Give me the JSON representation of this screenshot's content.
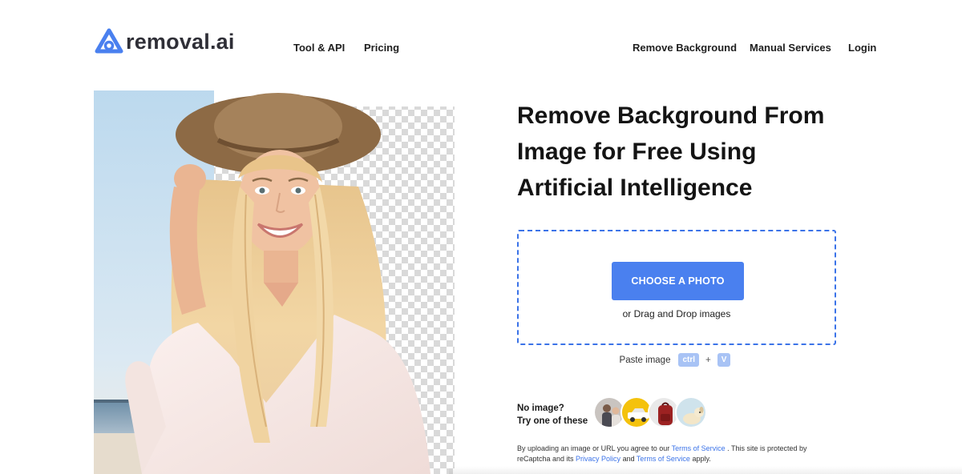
{
  "brand": {
    "name": "removal.ai",
    "accent": "#4a80ef",
    "logo_icon": "removal-ai-logo-icon"
  },
  "nav": {
    "left": [
      {
        "label": "Tool & API"
      },
      {
        "label": "Pricing"
      }
    ],
    "right": [
      {
        "label": "Remove Background"
      },
      {
        "label": "Manual Services"
      },
      {
        "label": "Login"
      }
    ]
  },
  "hero": {
    "title_lines": [
      "Remove Background From",
      "Image for Free Using",
      "Artificial Intelligence"
    ]
  },
  "upload": {
    "button_label": "CHOOSE A PHOTO",
    "drag_text": "or Drag and Drop images",
    "paste_label": "Paste image",
    "key_1": "ctrl",
    "plus": "+",
    "key_2": "V"
  },
  "samples": {
    "line_1": "No image?",
    "line_2": "Try one of these"
  },
  "legal": {
    "part_1": "By uploading an image or URL you agree to our ",
    "link_1": "Terms of Service",
    "part_2": " . This site is protected by reCaptcha and its ",
    "link_2": "Privacy Policy",
    "part_3": " and ",
    "link_3": "Terms of Service",
    "part_4": " apply."
  }
}
